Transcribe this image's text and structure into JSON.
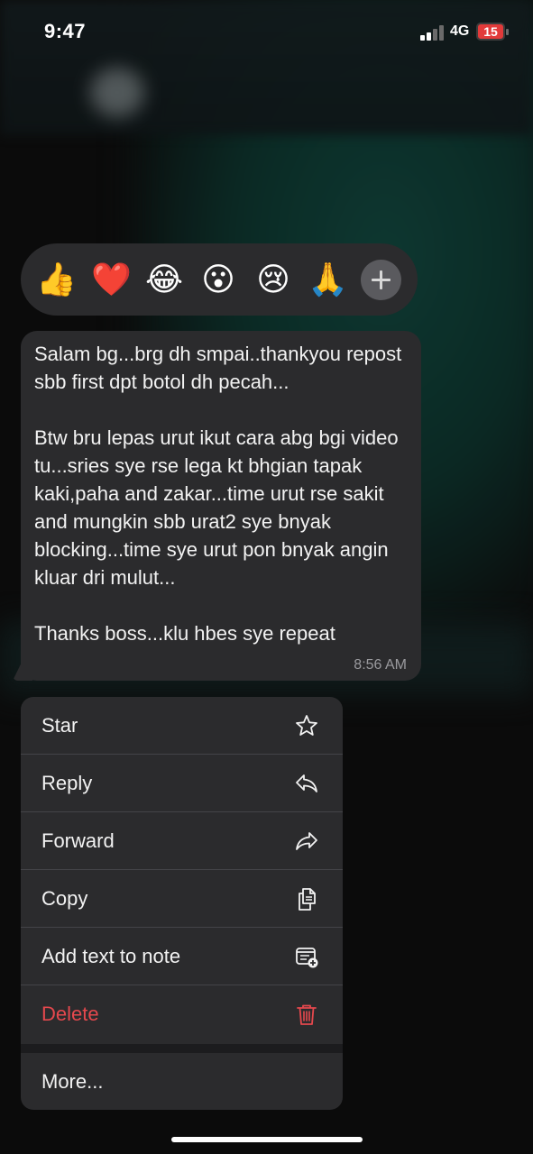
{
  "status_bar": {
    "time": "9:47",
    "network": "4G",
    "battery": "15"
  },
  "reactions": [
    {
      "emoji": "👍",
      "name": "thumbs-up"
    },
    {
      "emoji": "❤️",
      "name": "red-heart"
    },
    {
      "emoji": "😂",
      "name": "tears-of-joy"
    },
    {
      "emoji": "😮",
      "name": "open-mouth"
    },
    {
      "emoji": "😢",
      "name": "crying-face"
    },
    {
      "emoji": "🙏",
      "name": "folded-hands"
    }
  ],
  "message": {
    "para1": "Salam bg...brg dh smpai..thankyou repost sbb first dpt botol dh pecah...",
    "para2": "Btw bru lepas urut ikut cara abg bgi video tu...sries sye rse lega kt bhgian tapak kaki,paha and zakar...time urut rse sakit and mungkin sbb urat2 sye bnyak blocking...time sye urut pon bnyak angin kluar dri mulut...",
    "para3": "Thanks boss...klu hbes sye repeat",
    "time": "8:56 AM"
  },
  "menu": {
    "star": "Star",
    "reply": "Reply",
    "forward": "Forward",
    "copy": "Copy",
    "add_note": "Add text to note",
    "delete": "Delete",
    "more": "More..."
  },
  "colors": {
    "danger": "#e5484d",
    "panel": "#2b2b2d"
  }
}
